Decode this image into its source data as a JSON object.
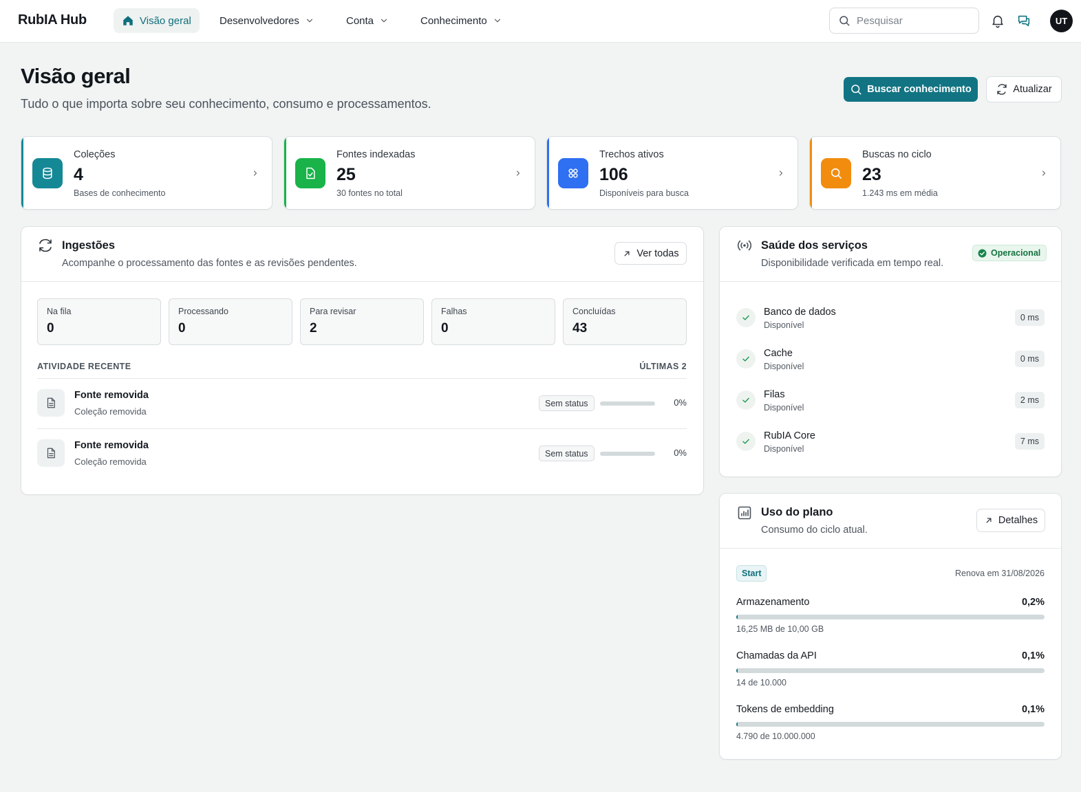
{
  "app": {
    "brand": "RubIA Hub"
  },
  "nav": {
    "items": [
      {
        "label": "Visão geral",
        "icon": "home-icon",
        "active": true
      },
      {
        "label": "Desenvolvedores",
        "icon": "chevron-down-icon"
      },
      {
        "label": "Conta",
        "icon": "chevron-down-icon"
      },
      {
        "label": "Conhecimento",
        "icon": "chevron-down-icon"
      }
    ],
    "search_placeholder": "Pesquisar",
    "avatar_initials": "UT"
  },
  "header": {
    "title": "Visão geral",
    "subtitle": "Tudo o que importa sobre seu conhecimento, consumo e processamentos.",
    "primary_button": "Buscar conhecimento",
    "refresh_button": "Atualizar"
  },
  "stats": [
    {
      "label": "Coleções",
      "value": "4",
      "sub": "Bases de conhecimento",
      "color": "#158896",
      "icon": "database-icon"
    },
    {
      "label": "Fontes indexadas",
      "value": "25",
      "sub": "30 fontes no total",
      "color": "#19b34a",
      "icon": "file-check-icon"
    },
    {
      "label": "Trechos ativos",
      "value": "106",
      "sub": "Disponíveis para busca",
      "color": "#2f6ff2",
      "icon": "grid-icon"
    },
    {
      "label": "Buscas no ciclo",
      "value": "23",
      "sub": "1.243 ms em média",
      "color": "#f28c0f",
      "icon": "search-icon"
    }
  ],
  "ingestions": {
    "title": "Ingestões",
    "subtitle": "Acompanhe o processamento das fontes e as revisões pendentes.",
    "view_all": "Ver todas",
    "metrics": [
      {
        "label": "Na fila",
        "value": "0"
      },
      {
        "label": "Processando",
        "value": "0"
      },
      {
        "label": "Para revisar",
        "value": "2"
      },
      {
        "label": "Falhas",
        "value": "0"
      },
      {
        "label": "Concluídas",
        "value": "43"
      }
    ],
    "recent_label": "ATIVIDADE RECENTE",
    "recent_count": "ÚLTIMAS 2",
    "activities": [
      {
        "title": "Fonte removida",
        "subtitle": "Coleção removida",
        "status": "Sem status",
        "progress": 0,
        "progress_label": "0%"
      },
      {
        "title": "Fonte removida",
        "subtitle": "Coleção removida",
        "status": "Sem status",
        "progress": 0,
        "progress_label": "0%"
      }
    ]
  },
  "health": {
    "title": "Saúde dos serviços",
    "subtitle": "Disponibilidade verificada em tempo real.",
    "status": "Operacional",
    "services": [
      {
        "name": "Banco de dados",
        "status": "Disponível",
        "latency": "0 ms"
      },
      {
        "name": "Cache",
        "status": "Disponível",
        "latency": "0 ms"
      },
      {
        "name": "Filas",
        "status": "Disponível",
        "latency": "2 ms"
      },
      {
        "name": "RubIA Core",
        "status": "Disponível",
        "latency": "7 ms"
      }
    ]
  },
  "plan": {
    "title": "Uso do plano",
    "subtitle": "Consumo do ciclo atual.",
    "details_button": "Detalhes",
    "plan_name": "Start",
    "renewal": "Renova em 31/08/2026",
    "usage": [
      {
        "name": "Armazenamento",
        "percent_label": "0,2%",
        "percent": 0.2,
        "detail": "16,25 MB de 10,00 GB"
      },
      {
        "name": "Chamadas da API",
        "percent_label": "0,1%",
        "percent": 0.1,
        "detail": "14 de 10.000"
      },
      {
        "name": "Tokens de embedding",
        "percent_label": "0,1%",
        "percent": 0.1,
        "detail": "4.790 de 10.000.000"
      }
    ]
  },
  "colors": {
    "accent": "#127483",
    "success": "#14733f"
  }
}
